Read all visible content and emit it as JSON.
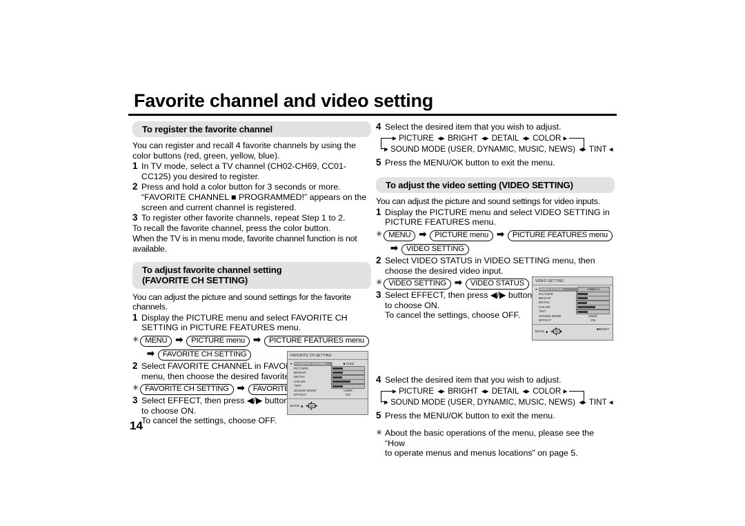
{
  "document": {
    "title": "Favorite channel and video setting",
    "page_number": "14"
  },
  "left_column": {
    "section1": {
      "heading": "To register the favorite channel",
      "intro": "You can register and recall 4 favorite channels by using the color buttons (red, green, yellow, blue).",
      "steps": [
        {
          "num": "1",
          "text": "In TV mode, select a TV channel (CH02-CH69, CC01-CC125) you desired to register."
        },
        {
          "num": "2",
          "text": "Press and hold a color button for 3 seconds or more. “FAVORITE CHANNEL ■ PROGRAMMED!” appears on the screen and current channel is registered."
        },
        {
          "num": "3",
          "text": "To register other favorite channels, repeat Step 1 to 2."
        }
      ],
      "note1": "To recall the favorite channel, press the color button.",
      "note2": "When the TV is in menu mode, favorite channel function is not available."
    },
    "section2": {
      "heading_line1": "To adjust favorite channel setting",
      "heading_line2": "(FAVORITE CH SETTING)",
      "intro": "You can adjust the picture and sound settings for the favorite channels.",
      "step1": {
        "num": "1",
        "text_line1": "Display the PICTURE menu and select FAVORITE CH",
        "text_line2": "SETTING in PICTURE FEATURES menu.",
        "path_row1": [
          "MENU",
          "PICTURE menu",
          "PICTURE FEATURES menu"
        ],
        "path_row2": [
          "FAVORITE CH SETTING"
        ]
      },
      "step2": {
        "num": "2",
        "text_line1": "Select FAVORITE CHANNEL in FAVORITE CH SETTING",
        "text_line2": "menu, then choose the desired favorite channel.",
        "path_row1": [
          "FAVORITE CH SETTING",
          "FAVORITE CHANNEL"
        ]
      },
      "step3": {
        "num": "3",
        "text_line1": "Select EFFECT, then press ◀/▶ button",
        "text_line2": "to choose ON.",
        "text_line3": "To cancel the settings, choose OFF."
      }
    }
  },
  "right_column": {
    "step4a": {
      "num": "4",
      "text": "Select the desired item that you wish to adjust.",
      "loop_row1": [
        "PICTURE",
        "BRIGHT",
        "DETAIL",
        "COLOR"
      ],
      "loop_row2": [
        "SOUND MODE (USER, DYNAMIC, MUSIC, NEWS)",
        "TINT"
      ]
    },
    "step5a": {
      "num": "5",
      "text": "Press the MENU/OK button to exit the menu."
    },
    "section3": {
      "heading": "To adjust the video setting (VIDEO SETTING)",
      "intro": "You can adjust the picture and sound settings for video inputs.",
      "step1": {
        "num": "1",
        "text_line1": "Display the PICTURE menu and select VIDEO SETTING in",
        "text_line2": "PICTURE FEATURES menu.",
        "path_row1": [
          "MENU",
          "PICTURE menu",
          "PICTURE FEATURES menu"
        ],
        "path_row2": [
          "VIDEO SETTING"
        ]
      },
      "step2": {
        "num": "2",
        "text_line1": "Select VIDEO STATUS in VIDEO SETTING menu, then",
        "text_line2": "choose the desired video input.",
        "path_row1": [
          "VIDEO SETTING",
          "VIDEO STATUS"
        ]
      },
      "step3": {
        "num": "3",
        "text_line1": "Select EFFECT, then press ◀/▶ button",
        "text_line2": "to choose ON.",
        "text_line3": "To cancel the settings, choose OFF."
      }
    },
    "step4b": {
      "num": "4",
      "text": "Select the desired item that you wish to adjust.",
      "loop_row1": [
        "PICTURE",
        "BRIGHT",
        "DETAIL",
        "COLOR"
      ],
      "loop_row2": [
        "SOUND MODE (USER, DYNAMIC, MUSIC, NEWS)",
        "TINT"
      ]
    },
    "step5b": {
      "num": "5",
      "text": "Press the MENU/OK button to exit the menu."
    },
    "footnote": {
      "line1": "About the basic operations of the menu, please see the “How",
      "line2": "to operate menus and menus locations” on page 5."
    }
  },
  "tv_menu_favorite": {
    "title": "FAVORITE CH SETTING",
    "rows": [
      {
        "label": "FAVORITE CHANNEL",
        "value": "CH02",
        "type": "value",
        "selected": true,
        "marker": "■"
      },
      {
        "label": "PICTURE",
        "type": "bar",
        "fill": 32
      },
      {
        "label": "BRIGHT",
        "type": "bar",
        "fill": 32
      },
      {
        "label": "DETAIL",
        "type": "bar",
        "fill": 30
      },
      {
        "label": "COLOR",
        "type": "bar",
        "fill": 56
      },
      {
        "label": "TINT",
        "type": "bar",
        "fill": 32
      },
      {
        "label": "SOUND MODE",
        "value": "USER",
        "type": "value"
      },
      {
        "label": "EFFECT",
        "value": "ON",
        "type": "value"
      }
    ],
    "footer": {
      "back": "BACK",
      "back_icon": "■",
      "dpad_center": "OK",
      "reset": ""
    }
  },
  "tv_menu_video": {
    "title": "VIDEO SETTING",
    "rows": [
      {
        "label": "VIDEO STATUS",
        "value": "VIDEO-1",
        "type": "boxvalue",
        "selected": true
      },
      {
        "label": "PICTURE",
        "type": "bar",
        "fill": 32
      },
      {
        "label": "BRIGHT",
        "type": "bar",
        "fill": 32
      },
      {
        "label": "DETAIL",
        "type": "bar",
        "fill": 30
      },
      {
        "label": "COLOR",
        "type": "bar",
        "fill": 56
      },
      {
        "label": "TINT",
        "type": "bar",
        "fill": 32
      },
      {
        "label": "SOUND MODE",
        "value": "USER",
        "type": "value"
      },
      {
        "label": "EFFECT",
        "value": "ON",
        "type": "value"
      }
    ],
    "footer": {
      "back": "BACK",
      "back_icon": "■",
      "dpad_center": "OK",
      "reset": "■RESET"
    }
  }
}
